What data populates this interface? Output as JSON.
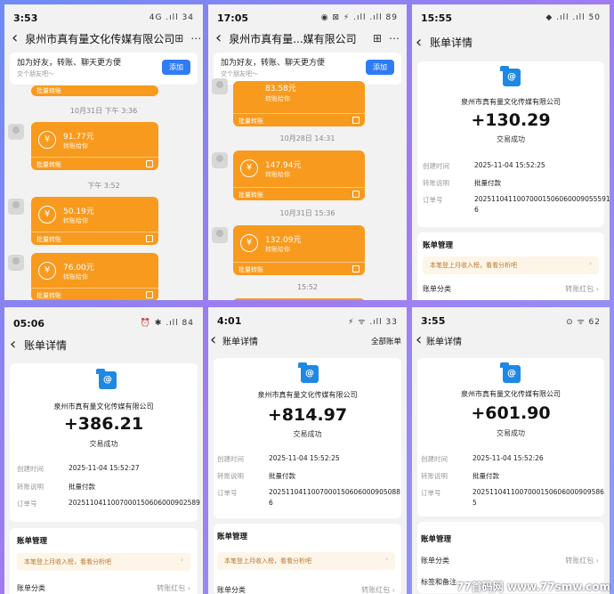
{
  "p1": {
    "time": "3:53",
    "status": "4G .ıll 34",
    "nav_title": "泉州市真有量文化传媒有限公司",
    "banner_title": "加为好友，转账、聊天更方便",
    "banner_sub": "交个朋友吧～",
    "add": "添加",
    "top_foot": "批量转账",
    "ts1": "10月31日 下午 3:36",
    "ts2": "下午 3:52",
    "b1": {
      "amount": "91.77元",
      "sub": "转账给你",
      "foot": "批量转账"
    },
    "b2": {
      "amount": "50.19元",
      "sub": "转账给你",
      "foot": "批量转账"
    },
    "b3": {
      "amount": "76.00元",
      "sub": "转账给你",
      "foot": "批量转账"
    }
  },
  "p2": {
    "time": "17:05",
    "status": "◉ ⊠ ⚡ .ıll .ıll 89",
    "nav_title": "泉州市真有量...媒有限公司",
    "banner_title": "加为好友，转账、聊天更方便",
    "banner_sub": "交个朋友吧～",
    "add": "添加",
    "b0": {
      "amount": "83.58元",
      "sub": "转账给你",
      "foot": "批量转账"
    },
    "ts1": "10月28日 14:31",
    "ts2": "10月31日 15:36",
    "ts3": "15:52",
    "b1": {
      "amount": "147.94元",
      "sub": "转账给你",
      "foot": "批量转账"
    },
    "b2": {
      "amount": "132.09元",
      "sub": "转账给你",
      "foot": "批量转账"
    }
  },
  "p3": {
    "time": "15:55",
    "status": "◆ .ıll .ıll 50",
    "title": "账单详情",
    "company": "泉州市真有量文化传媒有限公司",
    "amount": "+130.29",
    "state": "交易成功",
    "k1": "创建时间",
    "v1": "2025-11-04 15:52:25",
    "k2": "转账说明",
    "v2": "批量付款",
    "k3": "订单号",
    "v3a": "20251104110070001506060009055591",
    "v3b": "6",
    "mgmt": "账单管理",
    "tip": "本笔登上月收入榜，看看分析吧",
    "cls": "账单分类",
    "cls_v": "转账红包 ›"
  },
  "p4": {
    "time": "05:06",
    "status": "⏰ ✱ .ıll 84",
    "title": "账单详情",
    "company": "泉州市真有量文化传媒有限公司",
    "amount": "+386.21",
    "state": "交易成功",
    "k1": "创建时间",
    "v1": "2025-11-04 15:52:27",
    "k2": "转账说明",
    "v2": "批量付款",
    "k3": "订单号",
    "v3a": "2025110411007000150606000902589",
    "v3b": "0",
    "mgmt": "账单管理",
    "tip": "本笔登上月收入榜，看看分析吧",
    "cls": "账单分类",
    "cls_v": "转账红包 ›"
  },
  "p5": {
    "time": "4:01",
    "status": "⚡ ᯤ .ıll 33",
    "title": "账单详情",
    "right": "全部账单",
    "company": "泉州市真有量文化传媒有限公司",
    "amount": "+814.97",
    "state": "交易成功",
    "k1": "创建时间",
    "v1": "2025-11-04 15:52:25",
    "k2": "转账说明",
    "v2": "批量付款",
    "k3": "订单号",
    "v3a": "2025110411007000150606000905088",
    "v3b": "6",
    "mgmt": "账单管理",
    "tip": "本笔登上月收入榜，看看分析吧",
    "cls": "账单分类",
    "cls_v": "转账红包 ›"
  },
  "p6": {
    "time": "3:55",
    "status": "⊙ ᯤ 62",
    "title": "账单详情",
    "company": "泉州市真有量文化传媒有限公司",
    "amount": "+601.90",
    "state": "交易成功",
    "k1": "创建时间",
    "v1": "2025-11-04 15:52:26",
    "k2": "转账说明",
    "v2": "批量付款",
    "k3": "订单号",
    "v3a": "2025110411007000150606000909586",
    "v3b": "5",
    "mgmt": "账单管理",
    "cls": "账单分类",
    "cls_v": "转账红包 ›",
    "notes": "标签和备注"
  },
  "watermark": "77首码网 www.77smw.com"
}
